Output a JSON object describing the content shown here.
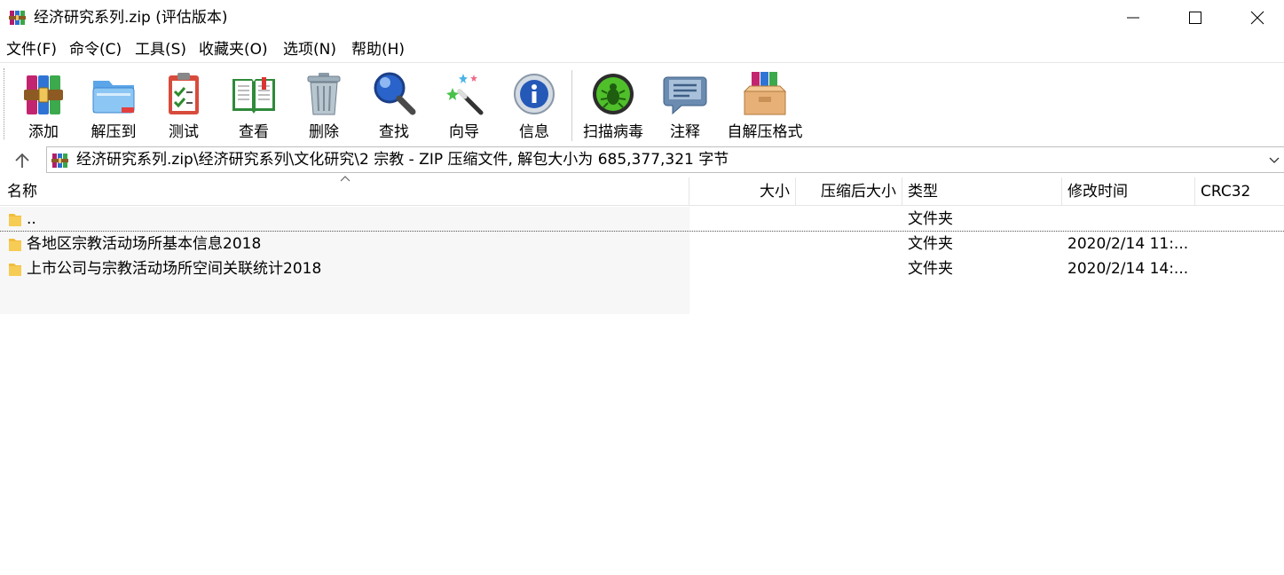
{
  "window": {
    "title": "经济研究系列.zip (评估版本)"
  },
  "menu": [
    {
      "label": "文件(F)"
    },
    {
      "label": "命令(C)"
    },
    {
      "label": "工具(S)"
    },
    {
      "label": "收藏夹(O)"
    },
    {
      "label": "选项(N)"
    },
    {
      "label": "帮助(H)"
    }
  ],
  "toolbar": [
    {
      "label": "添加",
      "icon": "archive-add-icon"
    },
    {
      "label": "解压到",
      "icon": "folder-extract-icon"
    },
    {
      "label": "测试",
      "icon": "clipboard-check-icon"
    },
    {
      "label": "查看",
      "icon": "open-book-icon"
    },
    {
      "label": "删除",
      "icon": "trash-can-icon"
    },
    {
      "label": "查找",
      "icon": "magnifier-icon"
    },
    {
      "label": "向导",
      "icon": "magic-wand-icon"
    },
    {
      "label": "信息",
      "icon": "info-icon"
    },
    {
      "label": "扫描病毒",
      "icon": "virus-scan-icon"
    },
    {
      "label": "注释",
      "icon": "comment-icon"
    },
    {
      "label": "自解压格式",
      "icon": "sfx-box-icon"
    }
  ],
  "address": {
    "path": "经济研究系列.zip\\经济研究系列\\文化研究\\2 宗教 - ZIP 压缩文件, 解包大小为 685,377,321 字节"
  },
  "columns": {
    "name": "名称",
    "size": "大小",
    "packed": "压缩后大小",
    "type": "类型",
    "modified": "修改时间",
    "crc": "CRC32"
  },
  "rows": [
    {
      "name": "..",
      "size": "",
      "packed": "",
      "type": "文件夹",
      "modified": "",
      "crc": ""
    },
    {
      "name": "各地区宗教活动场所基本信息2018",
      "size": "",
      "packed": "",
      "type": "文件夹",
      "modified": "2020/2/14 11:...",
      "crc": ""
    },
    {
      "name": "上市公司与宗教活动场所空间关联统计2018",
      "size": "",
      "packed": "",
      "type": "文件夹",
      "modified": "2020/2/14 14:...",
      "crc": ""
    }
  ],
  "colors": {
    "folder": "#f2bd3c",
    "selection_bg": "#f7f7f7"
  }
}
